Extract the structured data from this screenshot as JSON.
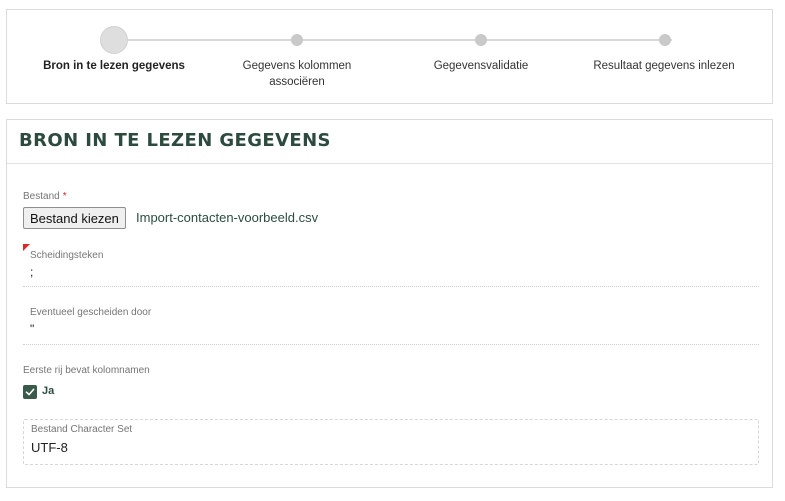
{
  "stepper": {
    "steps": [
      {
        "label": "Bron in te lezen gegevens",
        "active": true
      },
      {
        "label": "Gegevens kolommen associëren",
        "active": false
      },
      {
        "label": "Gegevensvalidatie",
        "active": false
      },
      {
        "label": "Resultaat gegevens inlezen",
        "active": false
      }
    ]
  },
  "form": {
    "title": "BRON IN TE LEZEN GEGEVENS",
    "file": {
      "label": "Bestand",
      "required_mark": "*",
      "button_label": "Bestand kiezen",
      "file_name": "Import-contacten-voorbeeld.csv"
    },
    "separator": {
      "label": "Scheidingsteken",
      "value": ";"
    },
    "enclosure": {
      "label": "Eventueel gescheiden door",
      "value": "\""
    },
    "header_row": {
      "label": "Eerste rij bevat kolomnamen",
      "checkbox_label": "Ja",
      "checked": true
    },
    "charset": {
      "label": "Bestand Character Set",
      "value": "UTF-8"
    }
  },
  "colors": {
    "accent": "#2d4a3e",
    "required": "#e0262b",
    "checkbox": "#3a5a4c"
  }
}
